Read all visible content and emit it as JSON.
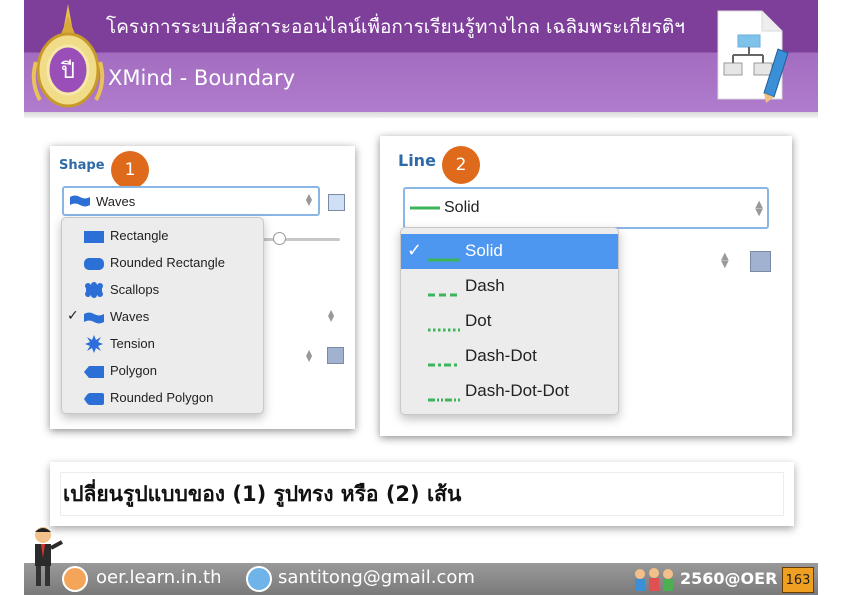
{
  "header": {
    "title": "โครงการระบบสื่อสาระออนไลน์เพื่อการเรียนรู้ทางไกล เฉลิมพระเกียรติฯ",
    "subtitle": "XMind - Boundary"
  },
  "panel_shape": {
    "title": "Shape",
    "badge": "1",
    "selected_value": "Waves",
    "options": [
      {
        "label": "Rectangle",
        "icon": "rectangle-shape-icon",
        "checked": false
      },
      {
        "label": "Rounded Rectangle",
        "icon": "rounded-rectangle-shape-icon",
        "checked": false
      },
      {
        "label": "Scallops",
        "icon": "scallops-shape-icon",
        "checked": false
      },
      {
        "label": "Waves",
        "icon": "waves-shape-icon",
        "checked": true
      },
      {
        "label": "Tension",
        "icon": "tension-shape-icon",
        "checked": false
      },
      {
        "label": "Polygon",
        "icon": "polygon-shape-icon",
        "checked": false
      },
      {
        "label": "Rounded Polygon",
        "icon": "rounded-polygon-shape-icon",
        "checked": false
      }
    ],
    "checkmark": "✓",
    "colors": {
      "icon": "#2c6fd6",
      "swatch_fill": "#cfe0f6",
      "swatch2": "#a0b2cf"
    }
  },
  "panel_line": {
    "title": "Line",
    "badge": "2",
    "selected_value": "Solid",
    "options": [
      {
        "label": "Solid",
        "style": "solid",
        "checked": true,
        "highlighted": true
      },
      {
        "label": "Dash",
        "style": "dash",
        "checked": false,
        "highlighted": false
      },
      {
        "label": "Dot",
        "style": "dot",
        "checked": false,
        "highlighted": false
      },
      {
        "label": "Dash-Dot",
        "style": "dash-dot",
        "checked": false,
        "highlighted": false
      },
      {
        "label": "Dash-Dot-Dot",
        "style": "dash-dot-dot",
        "checked": false,
        "highlighted": false
      }
    ],
    "checkmark": "✓",
    "colors": {
      "line": "#3cb55a",
      "highlight": "#4d97f0",
      "swatch": "#a0b2cf"
    }
  },
  "caption": "เปลี่ยนรูปแบบของ (1) รูปทรง หรือ (2) เส้น",
  "footer": {
    "website": "oer.learn.in.th",
    "email": "santitong@gmail.com",
    "brand": "2560@OER",
    "page_number": "163"
  },
  "colors": {
    "banner_dark": "#7e3f9a",
    "banner_light": "#b07ccc",
    "badge": "#e06a1c",
    "title_blue": "#2e6aa6"
  }
}
